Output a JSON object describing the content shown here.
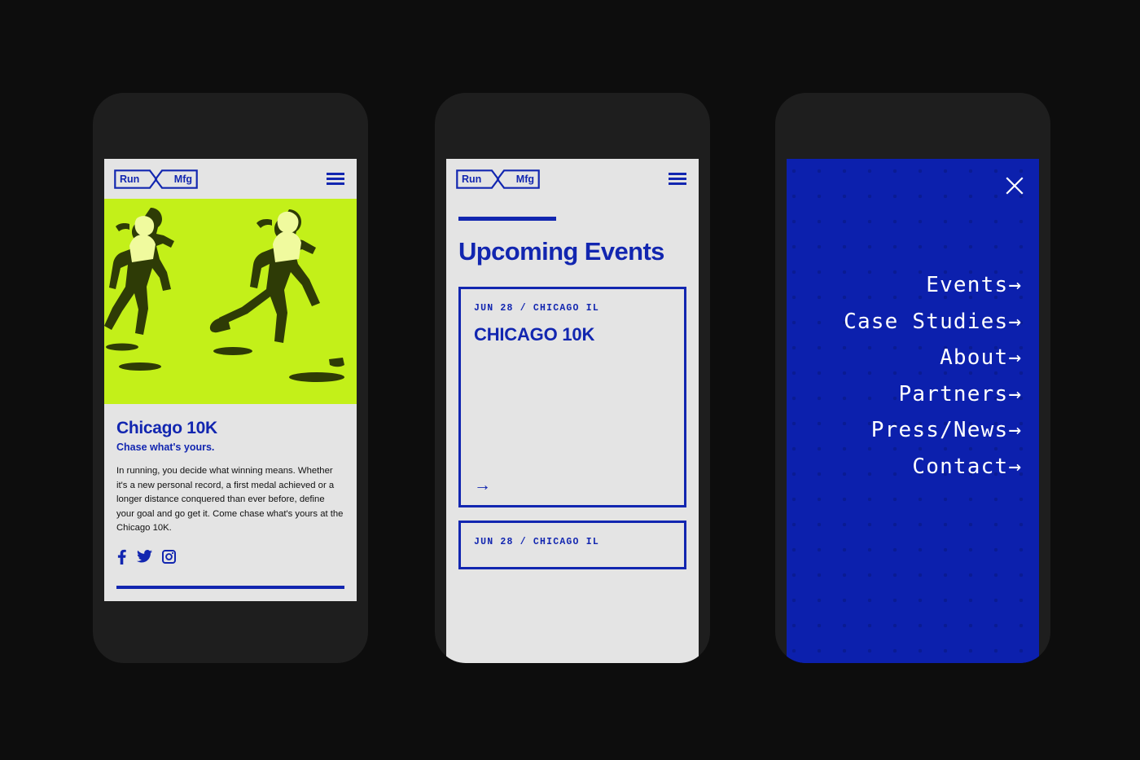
{
  "theme": {
    "background": "#0d0d0d",
    "phone_frame": "#1e1e1e",
    "screen_bg": "#e4e4e4",
    "brand_blue": "#1226b0",
    "menu_blue": "#0c20ad",
    "accent_green": "#c3f019",
    "text_dark": "#111111",
    "text_light": "#ffffff"
  },
  "brand": {
    "logo_left": "Run",
    "logo_right": "Mfg",
    "menu_icon": "hamburger-icon"
  },
  "phone1": {
    "name": "article-screen",
    "hero": {
      "icon": "runners-duotone-image",
      "alt": "Two female runners in green duotone"
    },
    "article": {
      "title": "Chicago 10K",
      "subtitle": "Chase what's yours.",
      "body": "In running, you decide what winning means. Whether it's a new personal record, a first medal achieved or a longer distance conquered than ever before, define your goal and go get it. Come chase what's yours at the Chicago 10K."
    },
    "socials": [
      {
        "name": "facebook-icon",
        "label": "Facebook"
      },
      {
        "name": "twitter-icon",
        "label": "Twitter"
      },
      {
        "name": "instagram-icon",
        "label": "Instagram"
      }
    ]
  },
  "phone2": {
    "name": "events-screen",
    "section_title": "Upcoming Events",
    "cards": [
      {
        "meta": "JUN 28 / CHICAGO IL",
        "title": "CHICAGO 10K",
        "arrow": "→"
      },
      {
        "meta": "JUN 28 / CHICAGO IL",
        "title": "",
        "arrow": ""
      }
    ]
  },
  "phone3": {
    "name": "menu-overlay-screen",
    "close_icon": "close-icon",
    "menu_items": [
      {
        "label": "Events",
        "arrow": "→"
      },
      {
        "label": "Case Studies",
        "arrow": "→"
      },
      {
        "label": "About",
        "arrow": "→"
      },
      {
        "label": "Partners",
        "arrow": "→"
      },
      {
        "label": "Press/News",
        "arrow": "→"
      },
      {
        "label": "Contact",
        "arrow": "→"
      }
    ]
  }
}
